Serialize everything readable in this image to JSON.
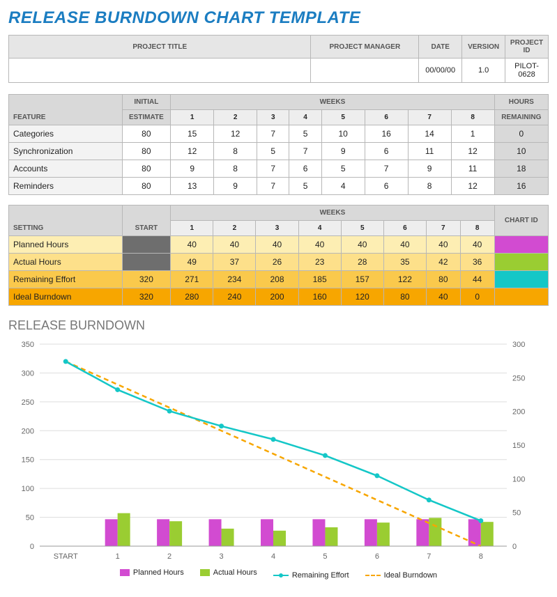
{
  "title": "RELEASE BURNDOWN CHART TEMPLATE",
  "project_info": {
    "headers": {
      "title": "PROJECT TITLE",
      "manager": "PROJECT MANAGER",
      "date": "DATE",
      "version": "VERSION",
      "id": "PROJECT ID"
    },
    "values": {
      "title": "",
      "manager": "",
      "date": "00/00/00",
      "version": "1.0",
      "id": "PILOT-0628"
    }
  },
  "feature_table": {
    "feature_label": "FEATURE",
    "initial_label_line1": "INITIAL",
    "initial_label_line2": "ESTIMATE",
    "weeks_label": "WEEKS",
    "hours_label_line1": "HOURS",
    "hours_label_line2": "REMAINING",
    "week_nums": [
      "1",
      "2",
      "3",
      "4",
      "5",
      "6",
      "7",
      "8"
    ],
    "rows": [
      {
        "name": "Categories",
        "initial": 80,
        "weeks": [
          15,
          12,
          7,
          5,
          10,
          16,
          14,
          1
        ],
        "remaining": 0
      },
      {
        "name": "Synchronization",
        "initial": 80,
        "weeks": [
          12,
          8,
          5,
          7,
          9,
          6,
          11,
          12
        ],
        "remaining": 10
      },
      {
        "name": "Accounts",
        "initial": 80,
        "weeks": [
          9,
          8,
          7,
          6,
          5,
          7,
          9,
          11
        ],
        "remaining": 18
      },
      {
        "name": "Reminders",
        "initial": 80,
        "weeks": [
          13,
          9,
          7,
          5,
          4,
          6,
          8,
          12
        ],
        "remaining": 16
      }
    ]
  },
  "setting_table": {
    "setting_label": "SETTING",
    "start_label": "START",
    "chartid_label": "CHART ID",
    "weeks_label": "WEEKS",
    "week_nums": [
      "1",
      "2",
      "3",
      "4",
      "5",
      "6",
      "7",
      "8"
    ],
    "rows": {
      "planned": {
        "name": "Planned Hours",
        "start": "",
        "weeks": [
          40,
          40,
          40,
          40,
          40,
          40,
          40,
          40
        ]
      },
      "actual": {
        "name": "Actual Hours",
        "start": "",
        "weeks": [
          49,
          37,
          26,
          23,
          28,
          35,
          42,
          36
        ]
      },
      "remain": {
        "name": "Remaining Effort",
        "start": 320,
        "weeks": [
          271,
          234,
          208,
          185,
          157,
          122,
          80,
          44
        ]
      },
      "ideal": {
        "name": "Ideal Burndown",
        "start": 320,
        "weeks": [
          280,
          240,
          200,
          160,
          120,
          80,
          40,
          0
        ]
      }
    }
  },
  "chart": {
    "title": "RELEASE BURNDOWN",
    "x_labels": [
      "START",
      "1",
      "2",
      "3",
      "4",
      "5",
      "6",
      "7",
      "8"
    ],
    "left_ticks": [
      0,
      50,
      100,
      150,
      200,
      250,
      300,
      350
    ],
    "right_ticks": [
      0,
      50,
      100,
      150,
      200,
      250,
      300
    ],
    "legend": {
      "planned": "Planned Hours",
      "actual": "Actual Hours",
      "remain": "Remaining Effort",
      "ideal": "Ideal Burndown"
    },
    "colors": {
      "planned": "#d24bd1",
      "actual": "#9acd32",
      "remain": "#14c7c7",
      "ideal": "#f7a600"
    }
  },
  "chart_data": {
    "type": "bar+line",
    "categories": [
      "START",
      "1",
      "2",
      "3",
      "4",
      "5",
      "6",
      "7",
      "8"
    ],
    "series": [
      {
        "name": "Planned Hours",
        "type": "bar",
        "values": [
          null,
          40,
          40,
          40,
          40,
          40,
          40,
          40,
          40
        ]
      },
      {
        "name": "Actual Hours",
        "type": "bar",
        "values": [
          null,
          49,
          37,
          26,
          23,
          28,
          35,
          42,
          36
        ]
      },
      {
        "name": "Remaining Effort",
        "type": "line",
        "values": [
          320,
          271,
          234,
          208,
          185,
          157,
          122,
          80,
          44
        ]
      },
      {
        "name": "Ideal Burndown",
        "type": "line_dashed",
        "values": [
          320,
          280,
          240,
          200,
          160,
          120,
          80,
          40,
          0
        ]
      }
    ],
    "title": "RELEASE BURNDOWN",
    "xlabel": "",
    "ylabel_left": "",
    "ylabel_right": "",
    "y_left_range": [
      0,
      350
    ],
    "y_right_range": [
      0,
      300
    ]
  }
}
